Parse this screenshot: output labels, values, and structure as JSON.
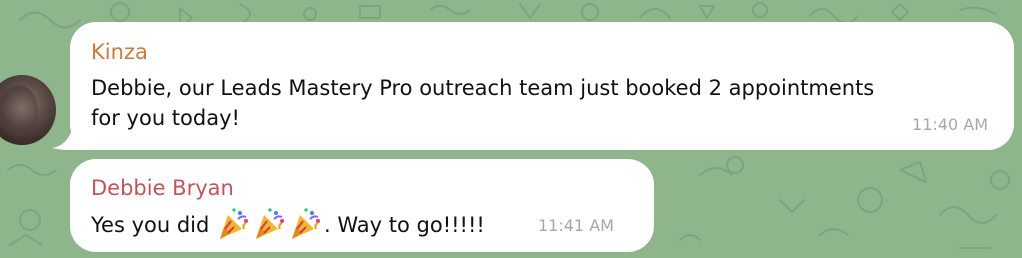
{
  "colors": {
    "chat_background": "#8fb58d",
    "bubble": "#ffffff",
    "sender_1": "#c87b3c",
    "sender_2": "#c0555c",
    "message_text": "#111111",
    "timestamp": "#a7a7a7"
  },
  "messages": [
    {
      "sender": "Kinza",
      "text_line_1": "Debbie, our Leads Mastery Pro outreach team just booked 2 appointments",
      "text_line_2": "for you today!",
      "time": "11:40 AM",
      "avatar_icon": "avatar-photo"
    },
    {
      "sender": "Debbie Bryan",
      "text_before_emoji": "Yes you did ",
      "emoji": [
        "party-popper-icon",
        "party-popper-icon",
        "party-popper-icon"
      ],
      "text_after_emoji": ". Way to go!!!!!",
      "time": "11:41 AM"
    }
  ]
}
